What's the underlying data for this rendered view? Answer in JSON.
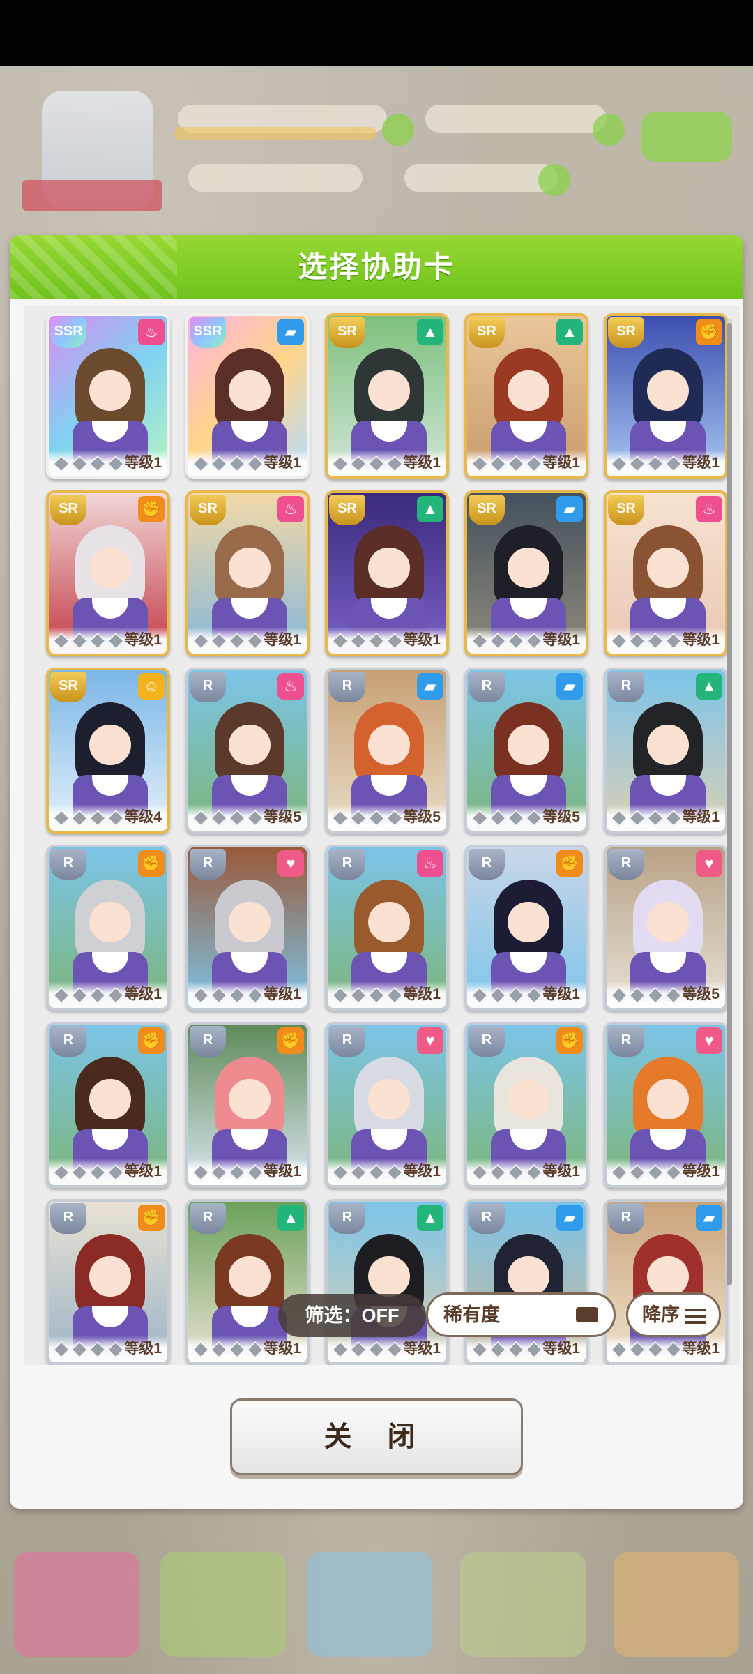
{
  "modal": {
    "title": "选择协助卡"
  },
  "cards": [
    {
      "rarity": "SSR",
      "type": "guts",
      "level": "等级1",
      "hair": "#6b4a2e",
      "bg": "linear-gradient(135deg,#d88cf1,#7fd2f1,#b7f5c2)"
    },
    {
      "rarity": "SSR",
      "type": "speed",
      "level": "等级1",
      "hair": "#5a2f28",
      "bg": "linear-gradient(135deg,#ffb3e1,#ffd58a,#b7dcff)"
    },
    {
      "rarity": "SR",
      "type": "wit",
      "level": "等级1",
      "hair": "#2e3636",
      "bg": "linear-gradient(#7fc07e,#cfe6d5)"
    },
    {
      "rarity": "SR",
      "type": "wit",
      "level": "等级1",
      "hair": "#9b3a22",
      "bg": "linear-gradient(#e9c79a,#c99a6c)"
    },
    {
      "rarity": "SR",
      "type": "power",
      "level": "等级1",
      "hair": "#1f2a55",
      "bg": "linear-gradient(#3c4fb0,#a9c7f2)"
    },
    {
      "rarity": "SR",
      "type": "power",
      "level": "等级1",
      "hair": "#e6e2e6",
      "bg": "linear-gradient(#f0d6d6,#c33c48)"
    },
    {
      "rarity": "SR",
      "type": "guts",
      "level": "等级1",
      "hair": "#9a6b4a",
      "bg": "linear-gradient(#f2d9a8,#86b7d8)"
    },
    {
      "rarity": "SR",
      "type": "wit",
      "level": "等级1",
      "hair": "#5a2d26",
      "bg": "linear-gradient(#3b2a7a,#7a61c9)"
    },
    {
      "rarity": "SR",
      "type": "speed",
      "level": "等级1",
      "hair": "#1f1f2a",
      "bg": "linear-gradient(#44515e,#8e8a7a)"
    },
    {
      "rarity": "SR",
      "type": "guts",
      "level": "等级1",
      "hair": "#8a5334",
      "bg": "linear-gradient(#f6e3d0,#e9c7b4)"
    },
    {
      "rarity": "SR",
      "type": "friend",
      "level": "等级4",
      "hair": "#1b1f2e",
      "bg": "linear-gradient(#7ab6e6,#e5f1fb)"
    },
    {
      "rarity": "R",
      "type": "guts",
      "level": "等级5",
      "hair": "#5b3a2b",
      "bg": "linear-gradient(#7cc4e8,#7cb67a)"
    },
    {
      "rarity": "R",
      "type": "speed",
      "level": "等级5",
      "hair": "#d4622f",
      "bg": "linear-gradient(#c7a074,#e8dcc6)"
    },
    {
      "rarity": "R",
      "type": "speed",
      "level": "等级5",
      "hair": "#7a3122",
      "bg": "linear-gradient(#7cc4e8,#7cb67a)"
    },
    {
      "rarity": "R",
      "type": "wit",
      "level": "等级1",
      "hair": "#222428",
      "bg": "linear-gradient(#7cc4e8,#d9cfb4)"
    },
    {
      "rarity": "R",
      "type": "power",
      "level": "等级1",
      "hair": "#cfd0d4",
      "bg": "linear-gradient(#7cc4e8,#7cb67a)"
    },
    {
      "rarity": "R",
      "type": "stamina",
      "level": "等级1",
      "hair": "#c9c9cf",
      "bg": "linear-gradient(#9a5a3a,#7cc4e8)"
    },
    {
      "rarity": "R",
      "type": "guts",
      "level": "等级1",
      "hair": "#9b5a2e",
      "bg": "linear-gradient(#7cc4e8,#7cb67a)"
    },
    {
      "rarity": "R",
      "type": "power",
      "level": "等级1",
      "hair": "#1c1c34",
      "bg": "linear-gradient(#c9d6e8,#7cc4e8)"
    },
    {
      "rarity": "R",
      "type": "stamina",
      "level": "等级5",
      "hair": "#e3dbf2",
      "bg": "linear-gradient(#b9a286,#e6e1d4)"
    },
    {
      "rarity": "R",
      "type": "power",
      "level": "等级1",
      "hair": "#4a2a1c",
      "bg": "linear-gradient(#7cc4e8,#7cb67a)"
    },
    {
      "rarity": "R",
      "type": "power",
      "level": "等级1",
      "hair": "#ef8a8e",
      "bg": "linear-gradient(#5f8a5a,#d9e6ee)"
    },
    {
      "rarity": "R",
      "type": "stamina",
      "level": "等级1",
      "hair": "#d9dbe4",
      "bg": "linear-gradient(#7cc4e8,#7cb67a)"
    },
    {
      "rarity": "R",
      "type": "power",
      "level": "等级1",
      "hair": "#e9e4dc",
      "bg": "linear-gradient(#7cc4e8,#7cb67a)"
    },
    {
      "rarity": "R",
      "type": "stamina",
      "level": "等级1",
      "hair": "#e57a2a",
      "bg": "linear-gradient(#7cc4e8,#7cb67a)"
    },
    {
      "rarity": "R",
      "type": "power",
      "level": "等级1",
      "hair": "#8a2b26",
      "bg": "linear-gradient(#e9e2d2,#9cb4c8)"
    },
    {
      "rarity": "R",
      "type": "wit",
      "level": "等级1",
      "hair": "#7a3a22",
      "bg": "linear-gradient(#6aa15a,#e8e1d0)"
    },
    {
      "rarity": "R",
      "type": "wit",
      "level": "等级1",
      "hair": "#1d1d22",
      "bg": "linear-gradient(#7cc4e8,#d9cfb4)"
    },
    {
      "rarity": "R",
      "type": "speed",
      "level": "等级1",
      "hair": "#1f2333",
      "bg": "linear-gradient(#7cc4e8,#c7b79a)"
    },
    {
      "rarity": "R",
      "type": "speed",
      "level": "等级1",
      "hair": "#a0302c",
      "bg": "linear-gradient(#c9a37a,#efe2cc)"
    }
  ],
  "toolbar": {
    "filter_label": "筛选：OFF",
    "sort_label": "稀有度",
    "order_label": "降序"
  },
  "footer": {
    "close_label": "关 闭"
  },
  "colors": {
    "header_green": "#7cc726",
    "accent_brown": "#5a3d2a"
  }
}
